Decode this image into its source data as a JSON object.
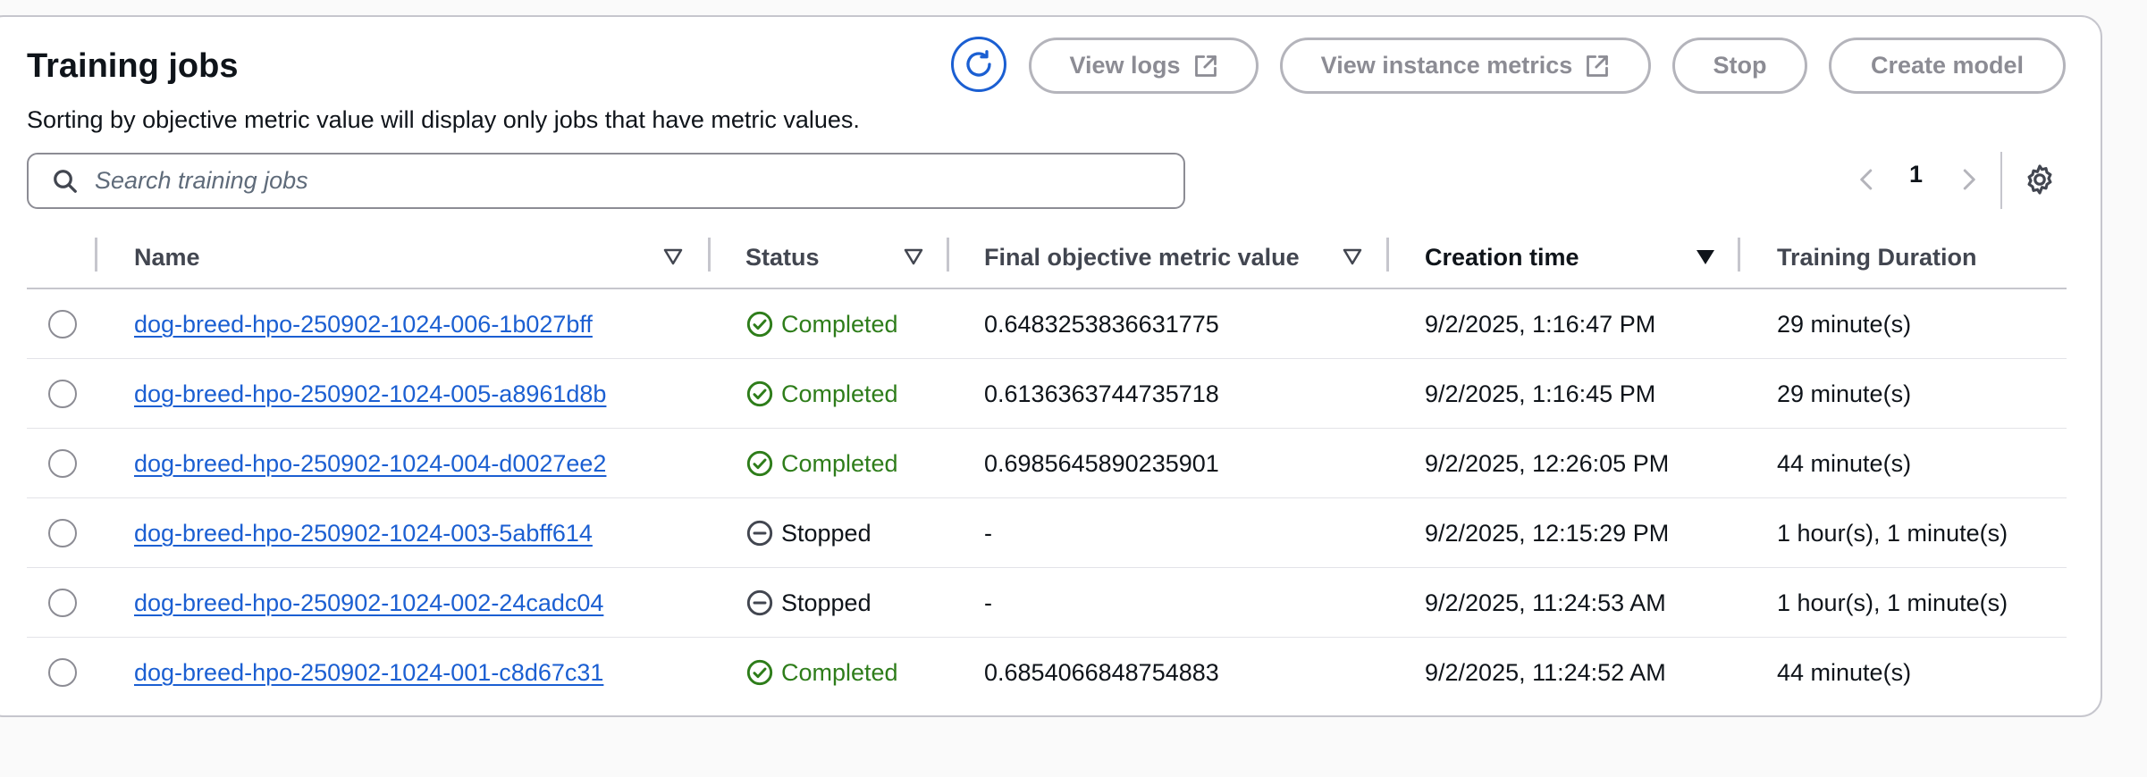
{
  "header": {
    "title": "Training jobs",
    "subtitle": "Sorting by objective metric value will display only jobs that have metric values."
  },
  "toolbar": {
    "view_logs": "View logs",
    "view_instance_metrics": "View instance metrics",
    "stop": "Stop",
    "create_model": "Create model"
  },
  "search": {
    "placeholder": "Search training jobs",
    "value": ""
  },
  "pagination": {
    "current_page": "1"
  },
  "table": {
    "columns": {
      "name": "Name",
      "status": "Status",
      "metric": "Final objective metric value",
      "creation": "Creation time",
      "duration": "Training Duration"
    },
    "sorted_by": "Creation time",
    "rows": [
      {
        "name": "dog-breed-hpo-250902-1024-006-1b027bff",
        "status": "Completed",
        "metric": "0.6483253836631775",
        "creation": "9/2/2025, 1:16:47 PM",
        "duration": "29 minute(s)"
      },
      {
        "name": "dog-breed-hpo-250902-1024-005-a8961d8b",
        "status": "Completed",
        "metric": "0.6136363744735718",
        "creation": "9/2/2025, 1:16:45 PM",
        "duration": "29 minute(s)"
      },
      {
        "name": "dog-breed-hpo-250902-1024-004-d0027ee2",
        "status": "Completed",
        "metric": "0.6985645890235901",
        "creation": "9/2/2025, 12:26:05 PM",
        "duration": "44 minute(s)"
      },
      {
        "name": "dog-breed-hpo-250902-1024-003-5abff614",
        "status": "Stopped",
        "metric": "-",
        "creation": "9/2/2025, 12:15:29 PM",
        "duration": "1 hour(s), 1 minute(s)"
      },
      {
        "name": "dog-breed-hpo-250902-1024-002-24cadc04",
        "status": "Stopped",
        "metric": "-",
        "creation": "9/2/2025, 11:24:53 AM",
        "duration": "1 hour(s), 1 minute(s)"
      },
      {
        "name": "dog-breed-hpo-250902-1024-001-c8d67c31",
        "status": "Completed",
        "metric": "0.6854066848754883",
        "creation": "9/2/2025, 11:24:52 AM",
        "duration": "44 minute(s)"
      }
    ]
  },
  "colors": {
    "link": "#1b5fd2",
    "success": "#2e7d1a",
    "disabled": "#8c8c94",
    "border": "#c6c6cd"
  },
  "icons": {
    "refresh": "refresh-icon",
    "external": "external-link-icon",
    "search": "search-icon",
    "prev": "chevron-left-icon",
    "next": "chevron-right-icon",
    "settings": "gear-icon",
    "completed": "check-circle-icon",
    "stopped": "stop-circle-icon"
  }
}
